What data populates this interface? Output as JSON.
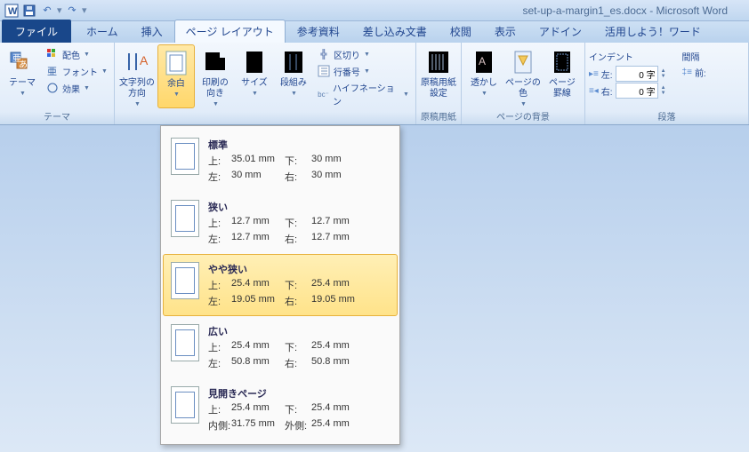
{
  "titlebar": {
    "document_title": "set-up-a-margin1_es.docx - Microsoft Word"
  },
  "tabs": {
    "file": "ファイル",
    "items": [
      "ホーム",
      "挿入",
      "ページ レイアウト",
      "参考資料",
      "差し込み文書",
      "校閲",
      "表示",
      "アドイン",
      "活用しよう！ワード"
    ],
    "active_index": 2
  },
  "ribbon": {
    "theme": {
      "themes": "テーマ",
      "colors": "配色",
      "fonts": "フォント",
      "effects": "効果",
      "group": "テーマ"
    },
    "page_setup": {
      "text_direction": "文字列の\n方向",
      "margins": "余白",
      "orientation": "印刷の\n向き",
      "size": "サイズ",
      "columns": "段組み",
      "breaks": "区切り",
      "line_numbers": "行番号",
      "hyphenation": "ハイフネーション"
    },
    "genkou": {
      "settings": "原稿用紙\n設定",
      "group": "原稿用紙"
    },
    "background": {
      "watermark": "透かし",
      "page_color": "ページの色",
      "page_borders": "ページ\n罫線",
      "group": "ページの背景"
    },
    "paragraph": {
      "indent_title": "インデント",
      "spacing_title": "間隔",
      "left_label": "左:",
      "right_label": "右:",
      "before_label": "前:",
      "left": "0 字",
      "right": "0 字",
      "group": "段落"
    }
  },
  "margins_menu": [
    {
      "name": "標準",
      "t": "35.01 mm",
      "l": "30 mm",
      "b": "30 mm",
      "r": "30 mm",
      "labels": [
        "上:",
        "左:",
        "下:",
        "右:"
      ]
    },
    {
      "name": "狭い",
      "t": "12.7 mm",
      "l": "12.7 mm",
      "b": "12.7 mm",
      "r": "12.7 mm",
      "labels": [
        "上:",
        "左:",
        "下:",
        "右:"
      ]
    },
    {
      "name": "やや狭い",
      "t": "25.4 mm",
      "l": "19.05 mm",
      "b": "25.4 mm",
      "r": "19.05 mm",
      "labels": [
        "上:",
        "左:",
        "下:",
        "右:"
      ]
    },
    {
      "name": "広い",
      "t": "25.4 mm",
      "l": "50.8 mm",
      "b": "25.4 mm",
      "r": "50.8 mm",
      "labels": [
        "上:",
        "左:",
        "下:",
        "右:"
      ]
    },
    {
      "name": "見開きページ",
      "t": "25.4 mm",
      "l": "31.75 mm",
      "b": "25.4 mm",
      "r": "25.4 mm",
      "labels": [
        "上:",
        "内側:",
        "下:",
        "外側:"
      ]
    }
  ],
  "margins_selected": 2
}
